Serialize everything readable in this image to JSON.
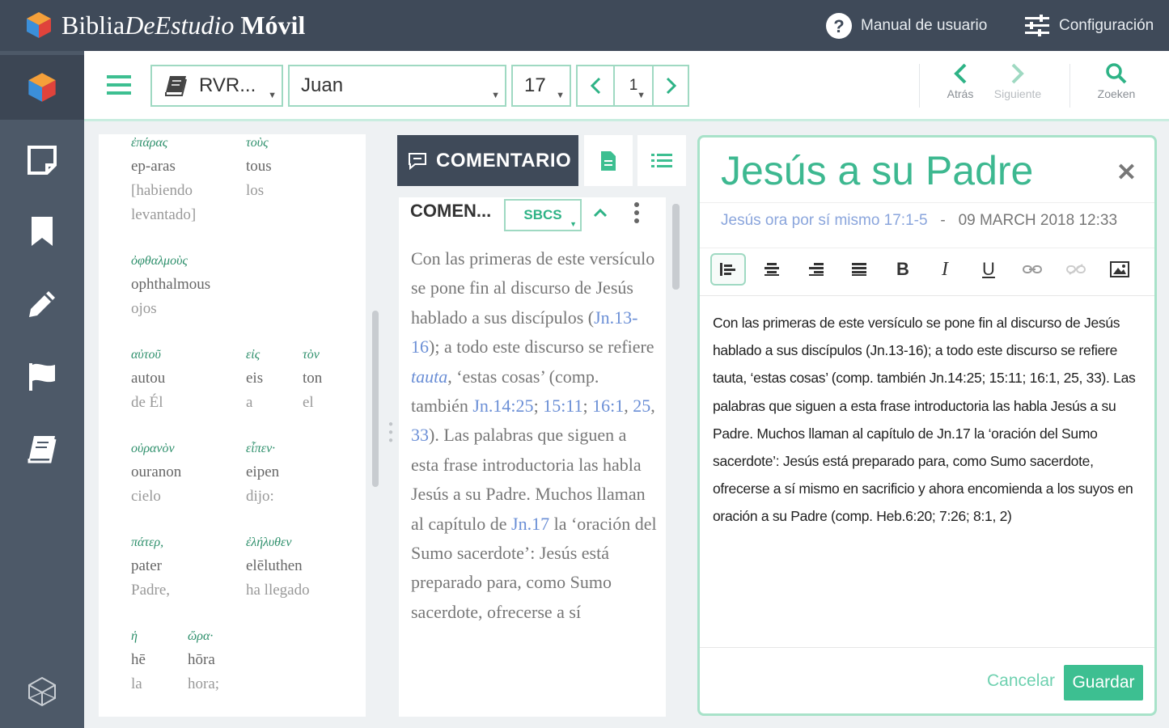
{
  "app": {
    "brand": {
      "part1": "Biblia",
      "part2": "DeEstudio",
      "part3": "Móvil"
    },
    "header_links": {
      "manual": "Manual de usuario",
      "config": "Configuración"
    }
  },
  "sidebar": {
    "items": [
      {
        "name": "app-logo-icon"
      },
      {
        "name": "notes-icon"
      },
      {
        "name": "bookmark-icon"
      },
      {
        "name": "pencil-icon"
      },
      {
        "name": "flag-icon"
      },
      {
        "name": "book-icon"
      },
      {
        "name": "cube-outline-icon"
      }
    ]
  },
  "toolbar": {
    "version": "RVR...",
    "book": "Juan",
    "chapter": "17",
    "verse": "1",
    "back_label": "Atrás",
    "next_label": "Siguiente",
    "search_label": "Zoeken"
  },
  "interlinear": {
    "words": [
      {
        "greek": "ἐπάρας",
        "translit": "ep-aras",
        "spanish": "[habiendo levantado]"
      },
      {
        "greek": "τοὺς",
        "translit": "tous",
        "spanish": "los"
      },
      {
        "greek": "ὀφθαλμοὺς",
        "translit": "ophthalmous",
        "spanish": "ojos"
      },
      {
        "greek": "αὐτοῦ",
        "translit": "autou",
        "spanish": "de Él"
      },
      {
        "greek": "εἰς",
        "translit": "eis",
        "spanish": "a"
      },
      {
        "greek": "τὸν",
        "translit": "ton",
        "spanish": "el"
      },
      {
        "greek": "οὐρανὸν",
        "translit": "ouranon",
        "spanish": "cielo"
      },
      {
        "greek": "εἶπεν·",
        "translit": "eipen",
        "spanish": "dijo:"
      },
      {
        "greek": "πάτερ,",
        "translit": "pater",
        "spanish": "Padre,"
      },
      {
        "greek": "ἐλήλυθεν",
        "translit": "elēluthen",
        "spanish": "ha llegado"
      },
      {
        "greek": "ἡ",
        "translit": "hē",
        "spanish": "la"
      },
      {
        "greek": "ὥρα·",
        "translit": "hōra",
        "spanish": "hora;"
      }
    ]
  },
  "commentary": {
    "tab_label": "COMENTARIO",
    "header_title": "COMEN...",
    "source": "SBCS",
    "segments": [
      {
        "text": "Con las primeras de este versículo se pone fin al discurso de Jesús hablado a sus discípulos (",
        "type": "plain"
      },
      {
        "text": "Jn.13-16",
        "type": "ref"
      },
      {
        "text": "); a todo este discurso se refiere ",
        "type": "plain"
      },
      {
        "text": "tauta",
        "type": "italic"
      },
      {
        "text": ", ‘estas cosas’ (comp. también ",
        "type": "plain"
      },
      {
        "text": "Jn.14:25",
        "type": "ref"
      },
      {
        "text": "; ",
        "type": "plain"
      },
      {
        "text": "15:11",
        "type": "ref"
      },
      {
        "text": "; ",
        "type": "plain"
      },
      {
        "text": "16:1",
        "type": "ref"
      },
      {
        "text": ", ",
        "type": "plain"
      },
      {
        "text": "25",
        "type": "ref"
      },
      {
        "text": ", ",
        "type": "plain"
      },
      {
        "text": "33",
        "type": "ref"
      },
      {
        "text": "). Las palabras que siguen a esta frase introductoria las habla Jesús a su Padre. Muchos llaman al capítulo de ",
        "type": "plain"
      },
      {
        "text": "Jn.17",
        "type": "ref"
      },
      {
        "text": " la ‘oración del Sumo sacerdote’: Jesús está preparado para, como Sumo sacerdote, ofrecerse a sí",
        "type": "plain"
      }
    ]
  },
  "note": {
    "title": "Jesús a su Padre",
    "ref": "Jesús ora por sí mismo 17:1-5",
    "separator": "-",
    "date": "09 MARCH 2018 12:33",
    "body": "Con las primeras de este versículo se pone fin al discurso de Jesús hablado a sus discípulos (Jn.13-16); a todo este discurso se refiere tauta, ‘estas cosas’ (comp. también Jn.14:25; 15:11; 16:1, 25, 33). Las palabras que siguen a esta frase introductoria las habla Jesús a su Padre. Muchos llaman al capítulo de Jn.17 la ‘oración del Sumo sacerdote’: Jesús está preparado para, como Sumo sacerdote, ofrecerse a sí mismo en sacrificio y ahora encomienda a los suyos en oración a su Padre (comp. Heb.6:20; 7:26; 8:1, 2)",
    "cancel_label": "Cancelar",
    "save_label": "Guardar"
  },
  "colors": {
    "accent": "#3dbf91",
    "header": "#3f4a59",
    "sidebar": "#4d5968",
    "link": "#6b8fd6"
  }
}
